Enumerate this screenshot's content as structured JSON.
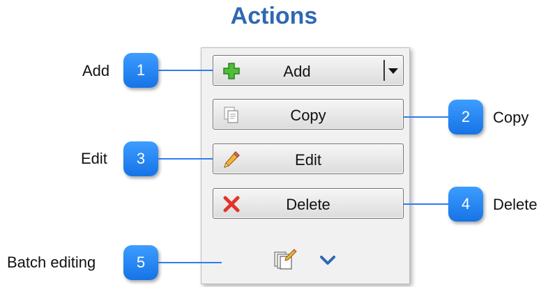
{
  "title": "Actions",
  "buttons": {
    "add": "Add",
    "copy": "Copy",
    "edit": "Edit",
    "delete": "Delete"
  },
  "callouts": [
    {
      "number": "1",
      "label": "Add"
    },
    {
      "number": "2",
      "label": "Copy"
    },
    {
      "number": "3",
      "label": "Edit"
    },
    {
      "number": "4",
      "label": "Delete"
    },
    {
      "number": "5",
      "label": "Batch editing"
    }
  ],
  "colors": {
    "title": "#2f68b3",
    "badge": "#1f83f5",
    "leader_line": "#2e7cf0"
  },
  "icons": {
    "add": "plus-icon",
    "add_dropdown": "caret-down-icon",
    "copy": "copy-icon",
    "edit": "pencil-icon",
    "delete": "x-icon",
    "batch": "batch-edit-icon",
    "expand": "chevron-down-icon"
  }
}
